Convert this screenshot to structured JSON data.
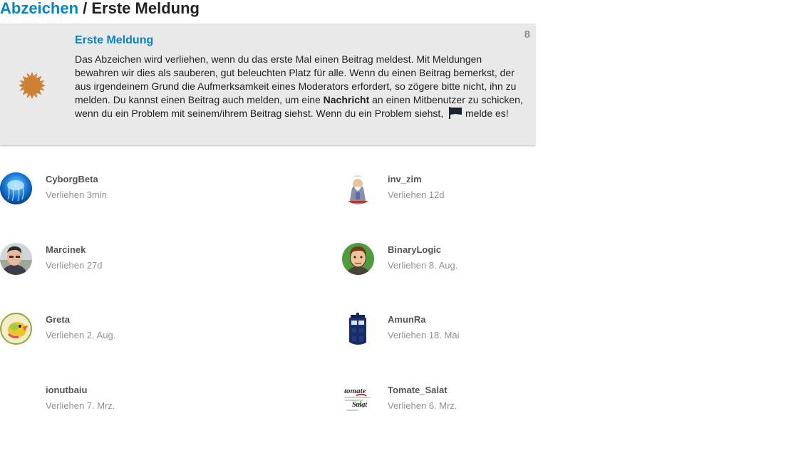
{
  "breadcrumb": {
    "parent_label": "Abzeichen",
    "separator": " / ",
    "current": "Erste Meldung"
  },
  "badge": {
    "name": "Erste Meldung",
    "count": "8",
    "icon": "badge-bronze-cog-icon",
    "icon_color": "#cd7f32",
    "desc_part1": "Das Abzeichen wird verliehen, wenn du das erste Mal einen Beitrag meldest. Mit Meldungen bewahren wir dies als sauberen, gut beleuchten Platz für alle. Wenn du einen Beitrag bemerkst, der aus irgendeinem Grund die Aufmerksamkeit eines Moderators erfordert, so zögere bitte nicht, ihn zu melden. Du kannst einen Beitrag auch melden, um eine ",
    "desc_bold": "Nachricht",
    "desc_part2": " an einen Mitbenutzer zu schicken, wenn du ein Problem mit seinem/ihrem Beitrag siehst. Wenn du ein Problem siehst, ",
    "flag_icon": "flag-icon",
    "desc_part3": " melde es!"
  },
  "colors": {
    "link": "#0a83c6",
    "card_bg": "#e9e9e9",
    "muted": "#919191"
  },
  "users": [
    {
      "name": "CyborgBeta",
      "granted": "Verliehen 3min",
      "avatar": "jellyfish-avatar"
    },
    {
      "name": "inv_zim",
      "granted": "Verliehen 12d",
      "avatar": "wizard-avatar"
    },
    {
      "name": "Marcinek",
      "granted": "Verliehen 27d",
      "avatar": "photo-avatar"
    },
    {
      "name": "BinaryLogic",
      "granted": "Verliehen 8. Aug.",
      "avatar": "cartoon-face-avatar"
    },
    {
      "name": "Greta",
      "granted": "Verliehen 2. Aug.",
      "avatar": "bird-avatar"
    },
    {
      "name": "AmunRa",
      "granted": "Verliehen 18. Mai",
      "avatar": "police-box-avatar"
    },
    {
      "name": "ionutbaiu",
      "granted": "Verliehen 7. Mrz.",
      "avatar": "empty-avatar"
    },
    {
      "name": "Tomate_Salat",
      "granted": "Verliehen 6. Mrz.",
      "avatar": "text-logo-avatar",
      "avatar_text_top": "tomate",
      "avatar_text_bottom": "Salat"
    }
  ]
}
